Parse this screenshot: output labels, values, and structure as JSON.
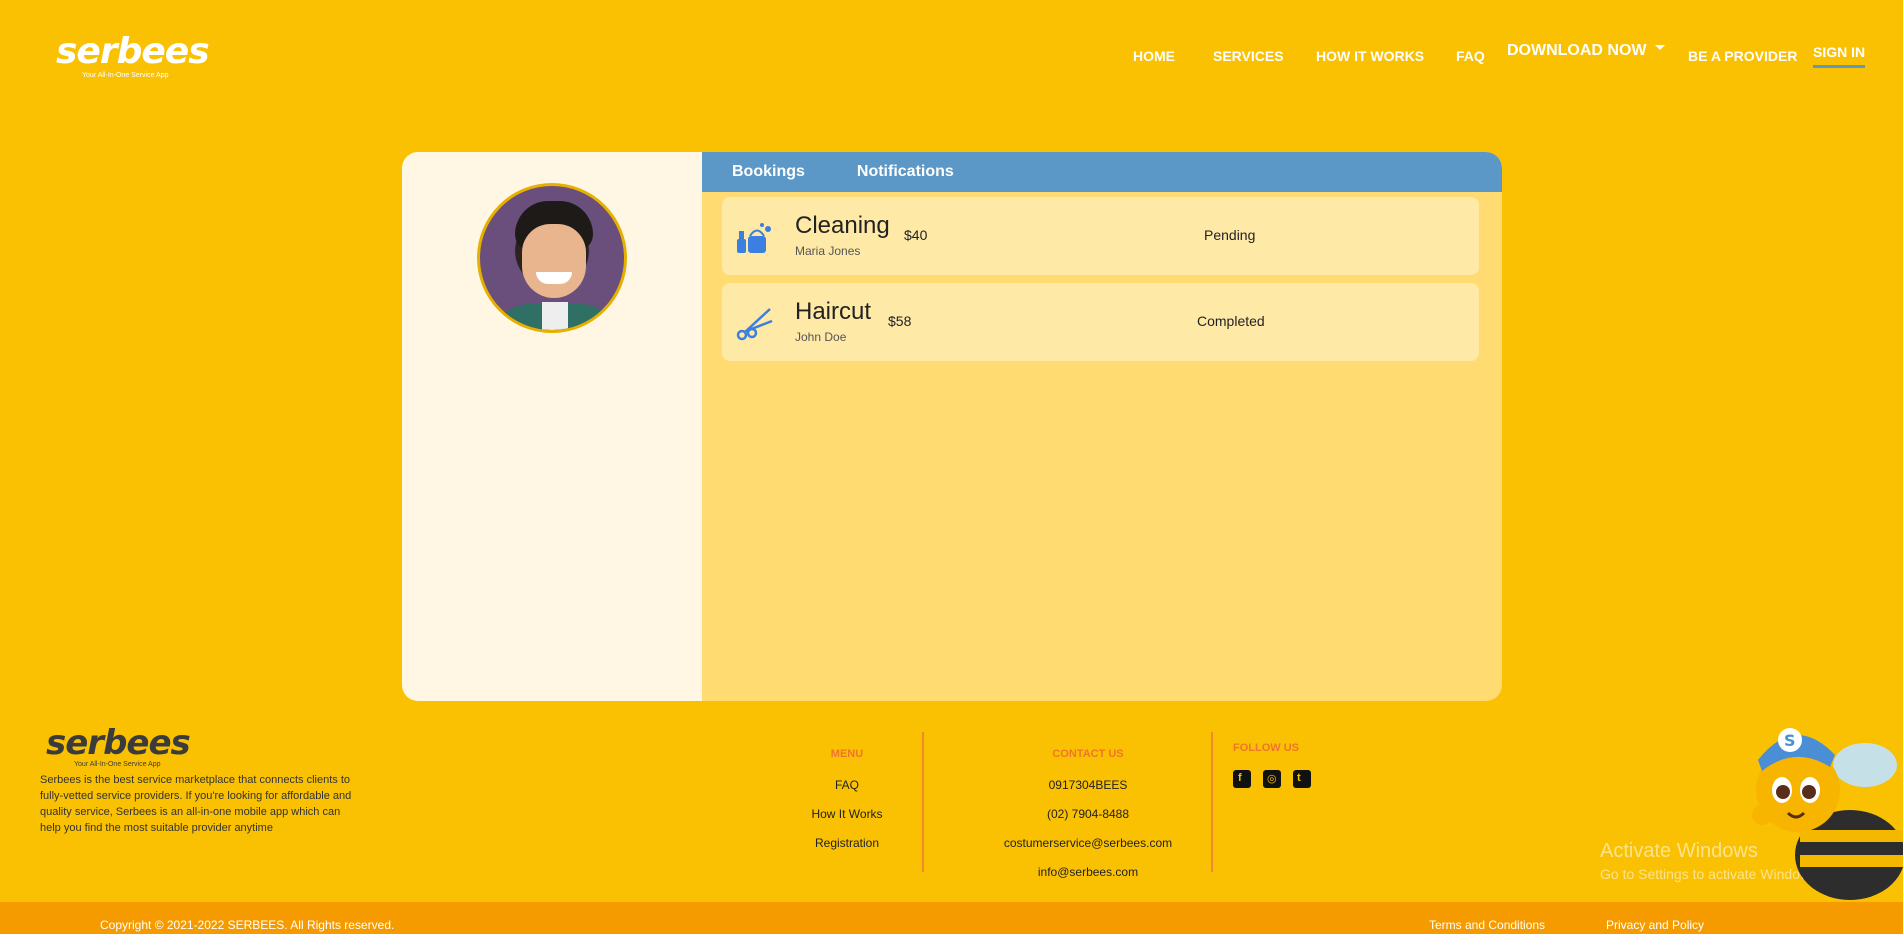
{
  "brand": {
    "name": "serbees",
    "tagline": "Your All-In-One Service App"
  },
  "nav": {
    "home": "HOME",
    "services": "SERVICES",
    "how_it_works": "HOW IT WORKS",
    "faq": "FAQ",
    "download": "DOWNLOAD NOW",
    "be_provider": "BE A PROVIDER",
    "sign_in": "SIGN IN"
  },
  "tabs": [
    "Bookings",
    "Notifications"
  ],
  "bookings": [
    {
      "service": "Cleaning",
      "customer": "Maria Jones",
      "price": "$40",
      "status": "Pending",
      "icon": "cleaning-icon"
    },
    {
      "service": "Haircut",
      "customer": "John Doe",
      "price": "$58",
      "status": "Completed",
      "icon": "scissors-icon"
    }
  ],
  "footer": {
    "about": "Serbees is the best service marketplace that connects clients to fully-vetted service providers. If you're looking for affordable and quality service, Serbees is an all-in-one mobile app which can help you find the most suitable provider anytime",
    "menu": {
      "heading": "MENU",
      "items": [
        "FAQ",
        "How It Works",
        "Registration"
      ]
    },
    "contact": {
      "heading": "CONTACT US",
      "items": [
        "0917304BEES",
        "(02) 7904-8488",
        "costumerservice@serbees.com",
        "info@serbees.com"
      ]
    },
    "follow": {
      "heading": "FOLLOW US",
      "icons": [
        "facebook-icon",
        "instagram-icon",
        "twitter-icon"
      ]
    },
    "copyright": "Copyright © 2021-2022 SERBEES. All Rights reserved.",
    "terms": "Terms and Conditions",
    "privacy": "Privacy and Policy"
  },
  "watermark": {
    "title": "Activate Windows",
    "subtitle": "Go to Settings to activate Windows."
  },
  "colors": {
    "background": "#fac102",
    "tab_bar": "#5b98c7",
    "accent": "#f0752b",
    "bottom_bar": "#f59b00"
  }
}
